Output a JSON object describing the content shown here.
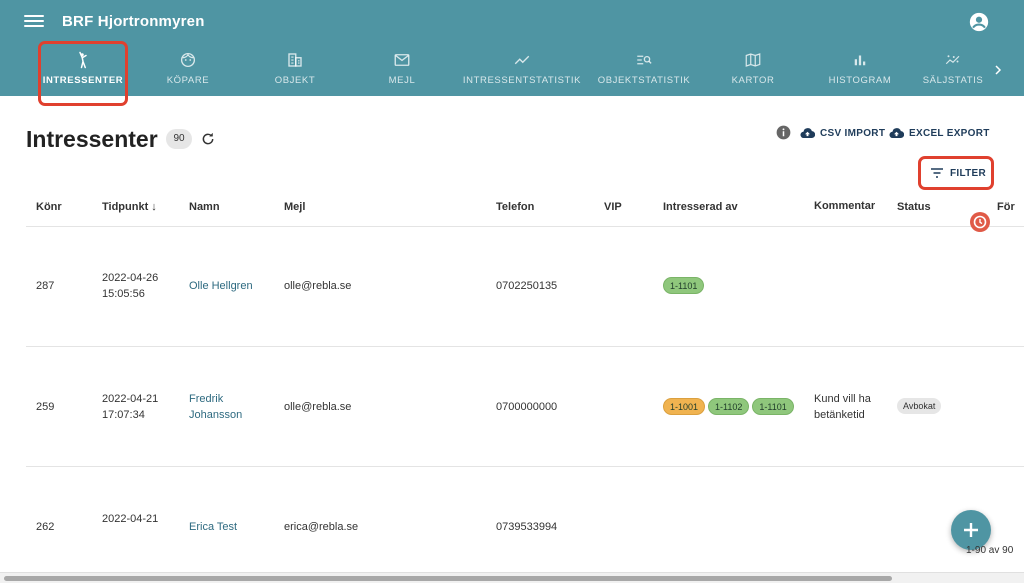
{
  "app": {
    "title": "BRF Hjortronmyren"
  },
  "tabs": [
    {
      "label": "INTRESSENTER",
      "icon": "person-raised-hand-icon",
      "active": true
    },
    {
      "label": "KÖPARE",
      "icon": "face-icon",
      "active": false
    },
    {
      "label": "OBJEKT",
      "icon": "building-icon",
      "active": false
    },
    {
      "label": "MEJL",
      "icon": "mail-icon",
      "active": false
    },
    {
      "label": "INTRESSENTSTATISTIK",
      "icon": "trend-line-icon",
      "active": false
    },
    {
      "label": "OBJEKTSTATISTIK",
      "icon": "list-search-icon",
      "active": false
    },
    {
      "label": "KARTOR",
      "icon": "map-icon",
      "active": false
    },
    {
      "label": "HISTOGRAM",
      "icon": "bar-chart-icon",
      "active": false
    },
    {
      "label": "SÄLJSTATIS",
      "icon": "scatter-icon",
      "active": false
    }
  ],
  "page": {
    "title": "Intressenter",
    "count": "90",
    "csv_import": "CSV IMPORT",
    "excel_export": "EXCEL EXPORT",
    "filter": "FILTER"
  },
  "table": {
    "headers": {
      "konr": "Könr",
      "tidpunkt": "Tidpunkt ↓",
      "namn": "Namn",
      "mejl": "Mejl",
      "telefon": "Telefon",
      "vip": "VIP",
      "intresserad": "Intresserad av",
      "kommentar": "Kommentar",
      "status": "Status",
      "extra": "För"
    },
    "rows": [
      {
        "konr": "287",
        "date": "2022-04-26",
        "time": "15:05:56",
        "name1": "Olle Hellgren",
        "name2": "",
        "email": "olle@rebla.se",
        "phone": "0702250135",
        "chips": [
          {
            "label": "1-1101",
            "color": "green"
          }
        ],
        "comment1": "",
        "comment2": "",
        "status": ""
      },
      {
        "konr": "259",
        "date": "2022-04-21",
        "time": "17:07:34",
        "name1": "Fredrik",
        "name2": "Johansson",
        "email": "olle@rebla.se",
        "phone": "0700000000",
        "chips": [
          {
            "label": "1-1001",
            "color": "orange"
          },
          {
            "label": "1-1102",
            "color": "green"
          },
          {
            "label": "1-1101",
            "color": "green"
          }
        ],
        "comment1": "Kund vill ha",
        "comment2": "betänketid",
        "status": "Avbokat"
      },
      {
        "konr": "262",
        "date": "2022-04-21",
        "time": "",
        "name1": "Erica Test",
        "name2": "",
        "email": "erica@rebla.se",
        "phone": "0739533994",
        "chips": [],
        "comment1": "",
        "comment2": "",
        "status": ""
      }
    ]
  },
  "pager": "1-90 av 90",
  "colors": {
    "primary": "#4f95a3",
    "highlight": "#e0402e",
    "chip_green": "#8fc77c",
    "chip_orange": "#f0b350"
  }
}
